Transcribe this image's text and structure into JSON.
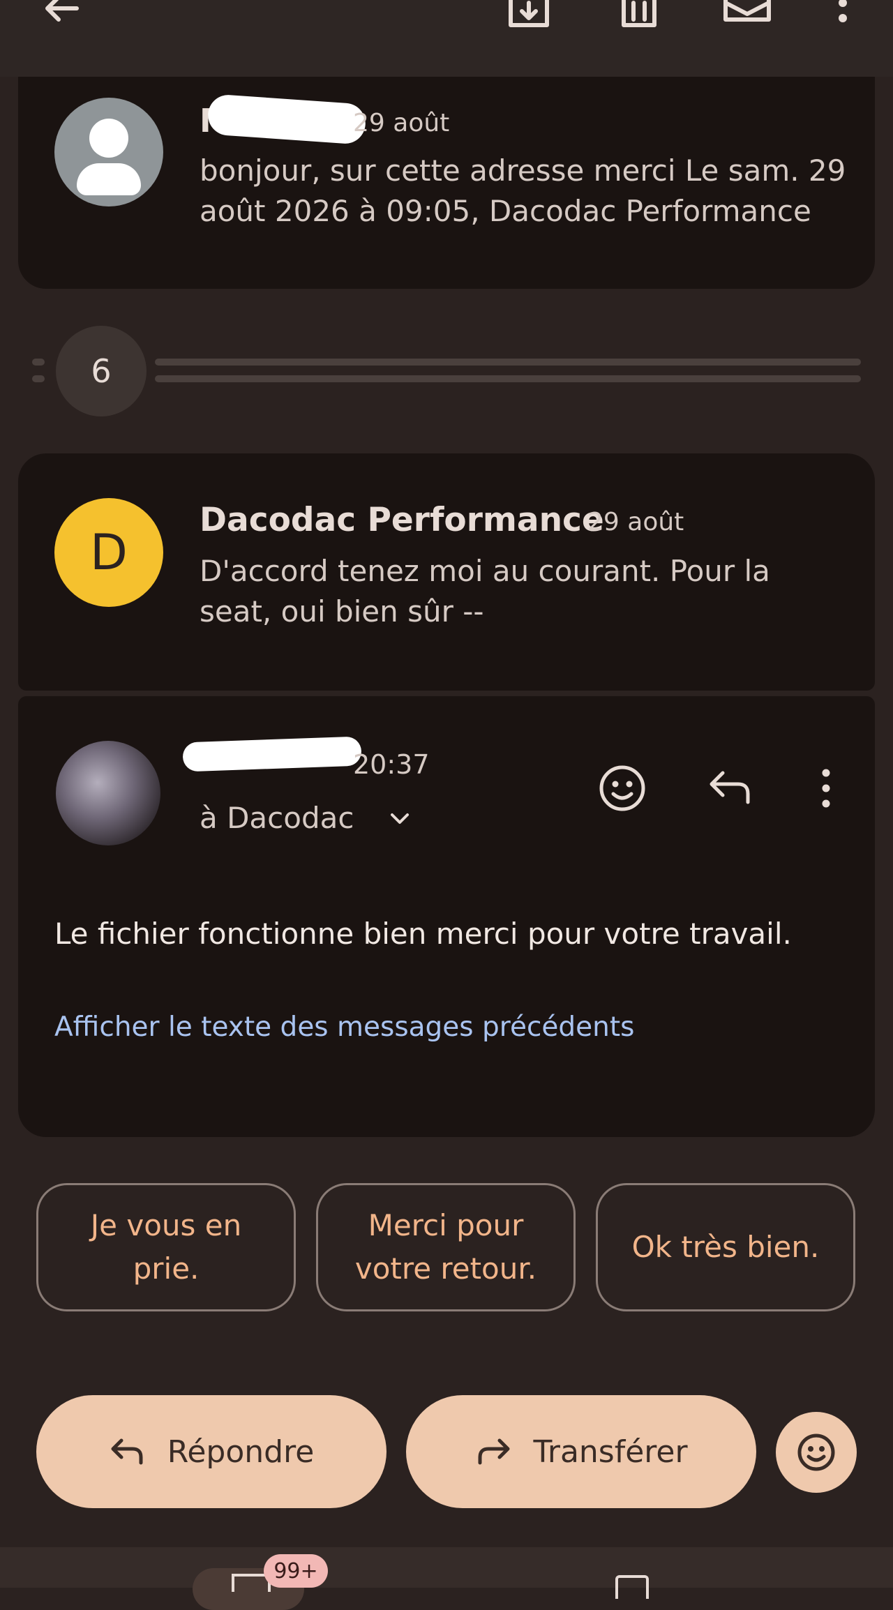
{
  "toolbar": {
    "back": "arrow-left-icon",
    "archive": "archive-icon",
    "delete": "trash-icon",
    "mark_unread": "mail-icon",
    "more": "more-vertical-icon"
  },
  "messages": [
    {
      "sender": "MOI",
      "date": "29 août",
      "preview": "bonjour, sur cette adresse merci Le sam. 29 août 2026 à 09:05, Dacodac Performance",
      "avatar": "person-icon",
      "avatar_color": "#8f9598"
    },
    {
      "collapsed_count": "6"
    },
    {
      "sender": "Dacodac Performance",
      "date": "29 août",
      "preview": "D'accord tenez moi au courant. Pour la seat, oui bien sûr --",
      "avatar_letter": "D",
      "avatar_color": "#f5c12e"
    },
    {
      "time": "20:37",
      "recipient": "à Dacodac",
      "body": "Le fichier fonctionne bien merci pour votre travail.",
      "show_quoted": "Afficher le texte des messages précédents"
    }
  ],
  "smart_replies": [
    "Je vous en\nprie.",
    "Merci pour\nvotre retour.",
    "Ok très bien."
  ],
  "actions": {
    "reply": "Répondre",
    "forward": "Transférer"
  },
  "bottom_nav": {
    "mail_badge": "99+"
  },
  "colors": {
    "background": "#2b2220",
    "card": "#1a1311",
    "accent": "#efc9ad",
    "link": "#a9c3f0",
    "chip_text": "#f2b58a"
  }
}
